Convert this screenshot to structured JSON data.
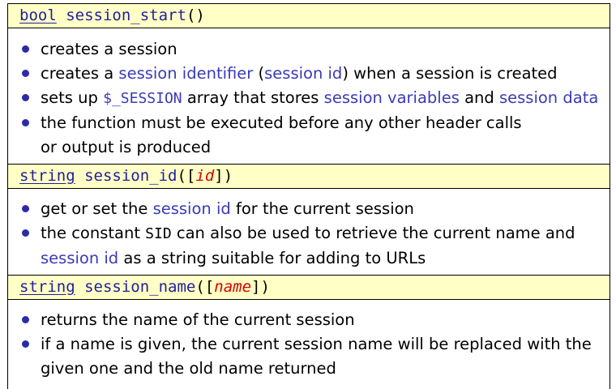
{
  "sections": [
    {
      "signature": {
        "type": "bool",
        "name": "session_start",
        "open": "(",
        "param": "",
        "close": ")"
      },
      "items": [
        [
          {
            "t": "creates a session"
          }
        ],
        [
          {
            "t": "creates a "
          },
          {
            "t": "session identifier",
            "hl": true
          },
          {
            "t": " ("
          },
          {
            "t": "session id",
            "hl": true
          },
          {
            "t": ") when a session is created"
          }
        ],
        [
          {
            "t": "sets up "
          },
          {
            "t": "$_SESSION",
            "hl": true,
            "mono": true
          },
          {
            "t": " array that stores "
          },
          {
            "t": "session variables",
            "hl": true
          },
          {
            "t": " and "
          },
          {
            "t": "session data",
            "hl": true
          }
        ],
        [
          {
            "t": "the function must be executed before any other header calls"
          }
        ],
        [
          {
            "t": "or output is produced"
          }
        ]
      ]
    },
    {
      "signature": {
        "type": "string",
        "name": "session_id",
        "open": "([",
        "param": "id",
        "close": "])"
      },
      "items": [
        [
          {
            "t": "get or set the "
          },
          {
            "t": "session id",
            "hl": true
          },
          {
            "t": " for the current session"
          }
        ],
        [
          {
            "t": "the constant "
          },
          {
            "t": "SID",
            "mono": true
          },
          {
            "t": " can also be used to retrieve the current name and"
          }
        ],
        [
          {
            "t": "session id",
            "hl": true
          },
          {
            "t": " as a string suitable for adding to URLs"
          }
        ]
      ]
    },
    {
      "signature": {
        "type": "string",
        "name": "session_name",
        "open": "([",
        "param": "name",
        "close": "])"
      },
      "items": [
        [
          {
            "t": "returns the name of the current session"
          }
        ],
        [
          {
            "t": "if a name is given, the current session name will be replaced with the"
          }
        ],
        [
          {
            "t": "given one and the old name returned"
          }
        ]
      ]
    }
  ],
  "colors": {
    "signature_bg": "#ffffc6",
    "keyword": "#1f1f9e",
    "parameter": "#d40000",
    "highlight": "#3a3ab8",
    "bullet": "#2b2ba8"
  }
}
